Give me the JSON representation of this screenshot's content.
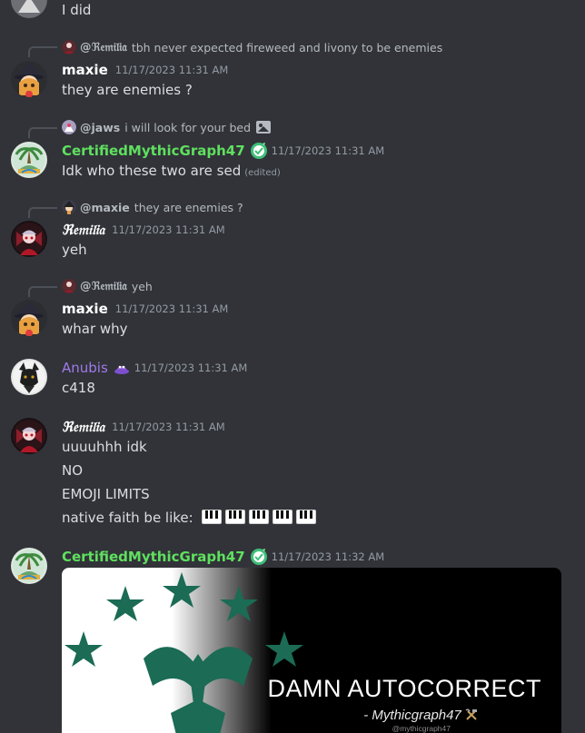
{
  "colors": {
    "background": "#313338",
    "text": "#dbdee1",
    "muted": "#949ba4",
    "maxie": "#ffffff",
    "remilia": "#ffffff",
    "certified": "#5fe05f",
    "anubis": "#9f7aea"
  },
  "messages": [
    {
      "text": "I did"
    },
    {
      "reply": {
        "name": "@ℜ𝔢𝔪𝔦𝔩𝔦𝔞",
        "text": "tbh never expected fireweed and livony to be enemies"
      },
      "author": "maxie",
      "timestamp": "11/17/2023 11:31 AM",
      "lines": [
        "they are enemies ?"
      ]
    },
    {
      "reply": {
        "name": "@jaws",
        "text": "i will look for your bed",
        "icon": "image-icon"
      },
      "author": "CertifiedMythicGraph47",
      "timestamp": "11/17/2023 11:31 AM",
      "lines": [
        "Idk who these two are sed"
      ],
      "edited": "(edited)"
    },
    {
      "reply": {
        "name": "@maxie",
        "text": "they are enemies ?"
      },
      "author": "ℜ𝔢𝔪𝔦𝔩𝔦𝔞",
      "timestamp": "11/17/2023 11:31 AM",
      "lines": [
        "yeh"
      ]
    },
    {
      "reply": {
        "name": "@ℜ𝔢𝔪𝔦𝔩𝔦𝔞",
        "text": "yeh"
      },
      "author": "maxie",
      "timestamp": "11/17/2023 11:31 AM",
      "lines": [
        "whar why"
      ]
    },
    {
      "author": "Anubis",
      "timestamp": "11/17/2023 11:31 AM",
      "lines": [
        "c418"
      ]
    },
    {
      "author": "ℜ𝔢𝔪𝔦𝔩𝔦𝔞",
      "timestamp": "11/17/2023 11:31 AM",
      "lines": [
        "uuuuhhh idk",
        "NO",
        "EMOJI LIMITS",
        "native faith be like:"
      ]
    },
    {
      "author": "CertifiedMythicGraph47",
      "timestamp": "11/17/2023 11:32 AM",
      "attachment": {
        "title": "DAMN AUTOCORRECT",
        "subtitle": "- Mythicgraph47",
        "handle": "@mythicgraph47"
      }
    }
  ]
}
